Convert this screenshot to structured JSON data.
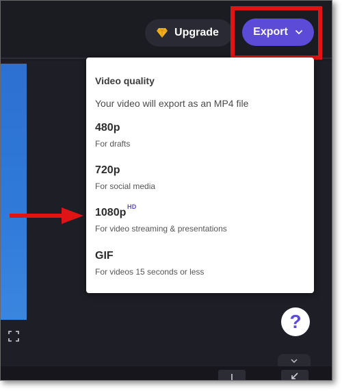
{
  "header": {
    "upgrade_label": "Upgrade",
    "export_label": "Export"
  },
  "export_menu": {
    "title": "Video quality",
    "subtitle": "Your video will export as an MP4 file",
    "options": [
      {
        "label": "480p",
        "description": "For drafts",
        "badge": ""
      },
      {
        "label": "720p",
        "description": "For social media",
        "badge": ""
      },
      {
        "label": "1080p",
        "description": "For video streaming & presentations",
        "badge": "HD"
      },
      {
        "label": "GIF",
        "description": "For videos 15 seconds or less",
        "badge": ""
      }
    ]
  },
  "help": {
    "label": "?"
  },
  "icons": {
    "upgrade": "diamond-icon",
    "export_dropdown": "chevron-down-icon",
    "fullscreen": "fullscreen-icon",
    "collapse": "chevron-down-icon",
    "timeline_split": "split-icon",
    "timeline_shrink": "arrow-down-left-icon"
  },
  "colors": {
    "accent": "#5b4bd6",
    "annotation": "#e01414",
    "background": "#1e1e26",
    "gem": "#f2b21b"
  }
}
